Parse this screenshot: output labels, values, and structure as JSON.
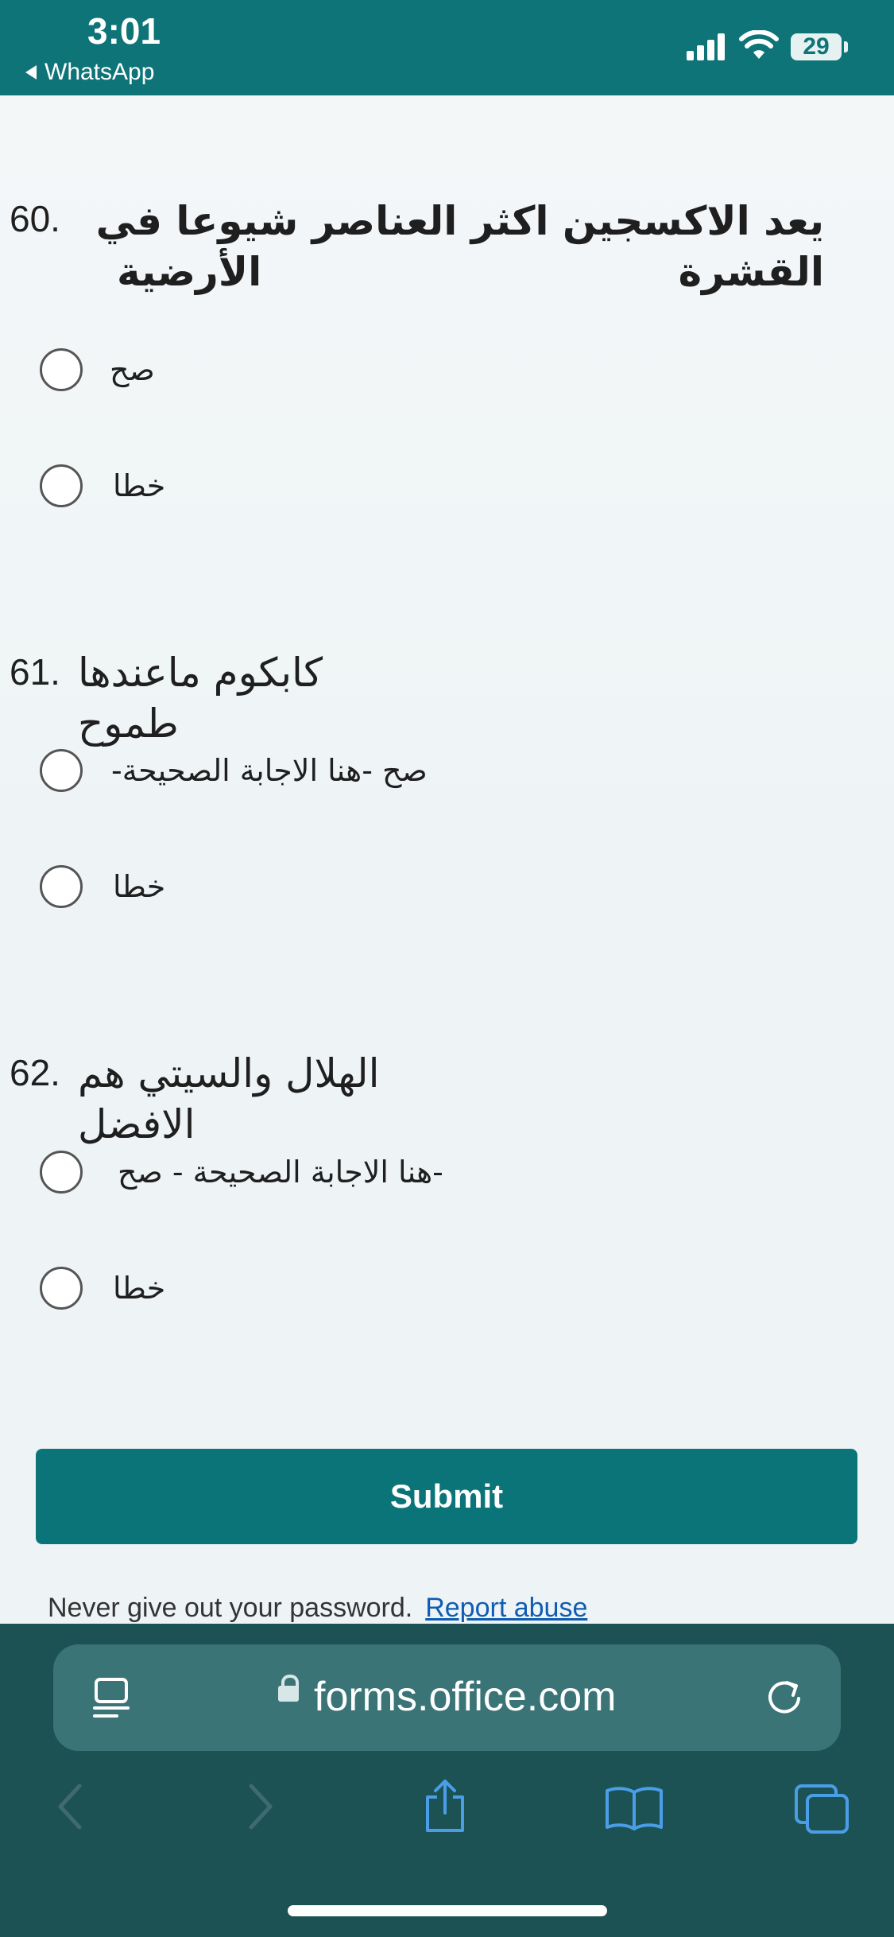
{
  "status_bar": {
    "time": "3:01",
    "back_app": "WhatsApp",
    "battery": "29"
  },
  "questions": [
    {
      "number": "60.",
      "text_line1": "يعد الاكسجين اكثر العناصر شيوعا في القشرة",
      "text_line2": "الأرضية",
      "options": [
        "صح",
        "خطا"
      ]
    },
    {
      "number": "61.",
      "text_line1": "كابكوم ماعندها طموح",
      "options": [
        "صح -هنا الاجابة الصحيحة-",
        "خطا"
      ]
    },
    {
      "number": "62.",
      "text_line1": "الهلال والسيتي هم الافضل",
      "options": [
        "-هنا الاجابة الصحيحة - صح",
        "خطا"
      ]
    }
  ],
  "submit_label": "Submit",
  "footer": {
    "note": "Never give out your password.",
    "link": "Report abuse"
  },
  "browser": {
    "url": "forms.office.com",
    "icons": {
      "reader": "reader-icon",
      "reload": "reload-icon",
      "back": "back-icon",
      "forward": "forward-icon",
      "share": "share-icon",
      "bookmarks": "bookmarks-icon",
      "tabs": "tabs-icon"
    }
  }
}
